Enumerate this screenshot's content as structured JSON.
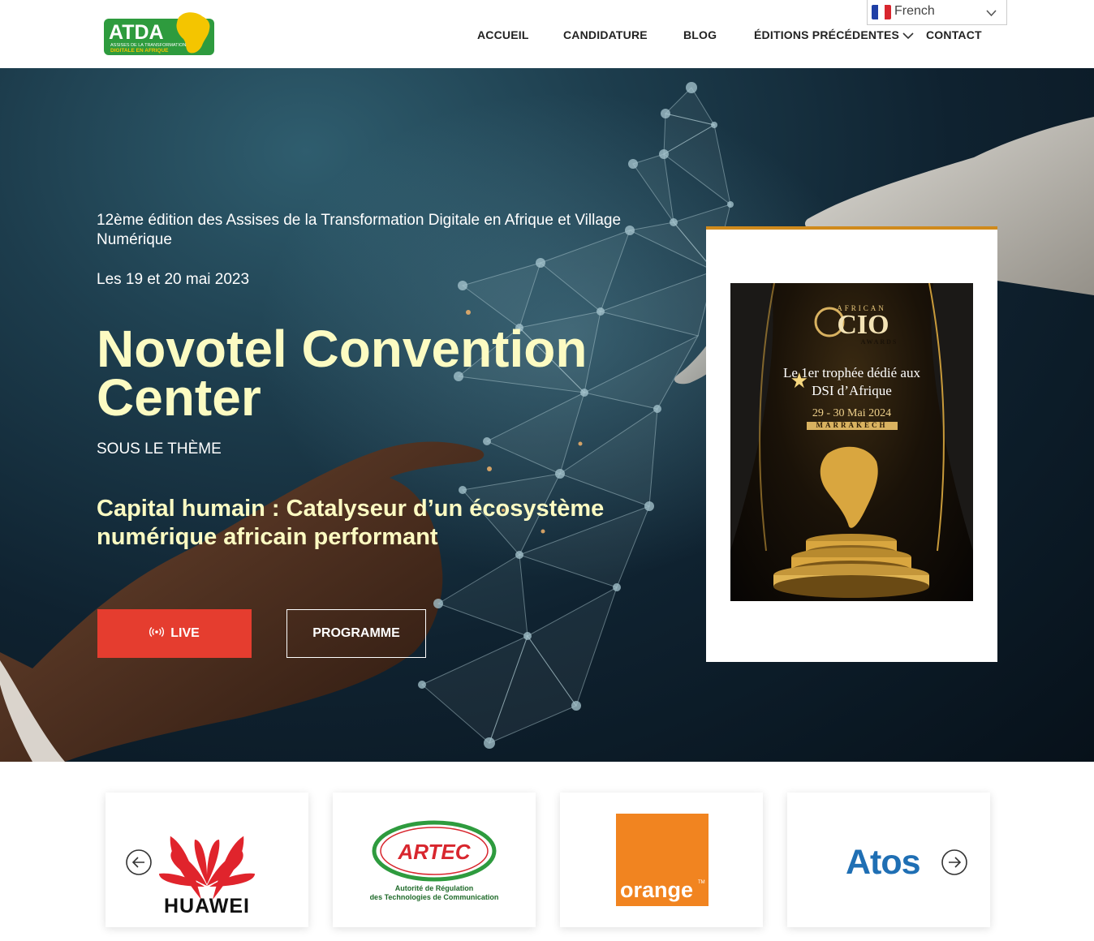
{
  "header": {
    "logo_text": "ATDA",
    "logo_subtext_1": "ASSISES DE LA TRANSFORMATION",
    "logo_subtext_2": "DIGITALE EN AFRIQUE",
    "nav": [
      {
        "label": "ACCUEIL"
      },
      {
        "label": "CANDIDATURE"
      },
      {
        "label": "BLOG"
      },
      {
        "label": "ÉDITIONS PRÉCÉDENTES",
        "has_dropdown": true
      },
      {
        "label": "CONTACT"
      }
    ],
    "language": {
      "selected": "French",
      "flag": "fr-flag-icon"
    }
  },
  "hero": {
    "edition": "12ème édition des Assises de la Transformation Digitale en Afrique et Village Numérique",
    "dates": "Les 19 et 20 mai 2023",
    "venue": "Novotel Convention Center",
    "theme_label": "SOUS LE THÈME",
    "theme": "Capital humain : Catalyseur d’un écosystème numérique africain performant",
    "live_button": "LIVE",
    "live_icon": "broadcast-icon",
    "program_button": "PROGRAMME"
  },
  "promo": {
    "african": "AFRICAN",
    "cio": "CIO",
    "awards": "AWARDS",
    "headline_1": "Le 1er trophée dédié aux",
    "headline_2": "DSI d’Afrique",
    "date": "29 - 30 Mai 2024",
    "city": "MARRAKECH"
  },
  "partners": {
    "logos": [
      {
        "name": "HUAWEI"
      },
      {
        "name": "ARTEC",
        "sub_1": "Autorité de Régulation",
        "sub_2": "des Technologies de Communication"
      },
      {
        "name": "orange"
      },
      {
        "name": "Atos"
      }
    ],
    "prev_icon": "arrow-left-circle-icon",
    "next_icon": "arrow-right-circle-icon"
  },
  "colors": {
    "accent_red": "#e53d2f",
    "hero_title": "#fcfbc2",
    "promo_border": "#d08a1c",
    "atda_green": "#2e9b3e",
    "huawei_red": "#e0242c",
    "orange_brand": "#f18420",
    "atos_blue": "#1f6fb4"
  }
}
